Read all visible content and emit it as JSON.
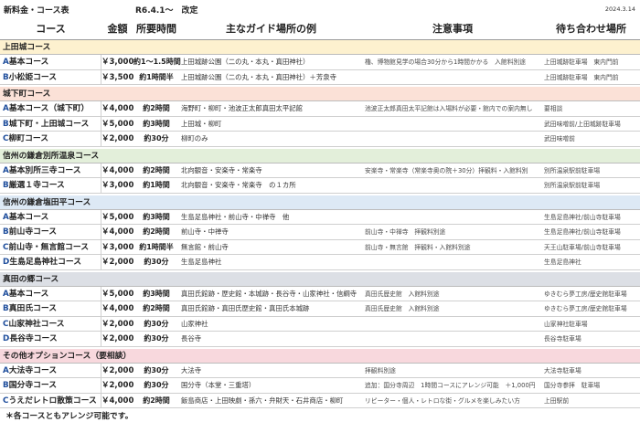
{
  "title": "新料金・コース表",
  "revision": "R6.4.1～　改定",
  "date": "2024.3.14",
  "columns": {
    "course": "コース",
    "price": "金額",
    "time": "所要時間",
    "places": "主なガイド場所の例",
    "notes": "注意事項",
    "meeting": "待ち合わせ場所"
  },
  "colors": {
    "letter": "#1f4e9c"
  },
  "sections": [
    {
      "name": "上田城コース",
      "color": "#fdf1cf",
      "rows": [
        {
          "letter": "A",
          "course": "基本コース",
          "price": "￥3,000",
          "time": "約1～1.5時間",
          "places": "上田城跡公園（二の丸・本丸・真田神社）",
          "notes": "櫓、博物館見学の場合30分から1時間かかる　入館料別途",
          "meeting": "上田城跡駐車場　東内門前"
        },
        {
          "letter": "B",
          "course": "小松姫コース",
          "price": "￥3,500",
          "time": "約1時間半",
          "places": "上田城跡公園（二の丸・本丸・真田神社）＋芳泉寺",
          "meeting": "上田城跡駐車場　東内門前"
        }
      ]
    },
    {
      "name": "城下町コース",
      "color": "#fbe1d7",
      "rows": [
        {
          "letter": "A",
          "course": "基本コース（城下町）",
          "price": "￥4,000",
          "time": "約2時間",
          "places": "海野町・柳町・池波正太郎真田太平記館",
          "notes": "池波正太郎真田太平記館は入場料が必要・館内での案内無し",
          "meeting": "要相談"
        },
        {
          "letter": "B",
          "course": "城下町・上田城コース",
          "price": "￥5,000",
          "time": "約3時間",
          "places": "上田城・柳町",
          "meeting": "武田味噌前/上田城跡駐車場"
        },
        {
          "letter": "C",
          "course": "柳町コース",
          "price": "￥2,000",
          "time": "約30分",
          "places": "柳町のみ",
          "meeting": "武田味噌前"
        }
      ]
    },
    {
      "name": "信州の鎌倉別所温泉コース",
      "color": "#e3efda",
      "rows": [
        {
          "letter": "A",
          "course": "基本別所三寺コース",
          "price": "￥4,000",
          "time": "約2時間",
          "places": "北向観音・安楽寺・常楽寺",
          "notes": "安楽寺・常楽寺（常楽寺奥の院＋30分）拝観料・入館料別",
          "meeting": "別所温泉駅前駐車場"
        },
        {
          "letter": "B",
          "course": "厳選１寺コース",
          "price": "￥3,000",
          "time": "約1時間",
          "places": "北向観音・安楽寺・常楽寺　の１カ所",
          "meeting": "別所温泉駅前駐車場"
        }
      ]
    },
    {
      "name": "信州の鎌倉塩田平コース",
      "color": "#dde9f5",
      "rows": [
        {
          "letter": "A",
          "course": "基本コース",
          "price": "￥5,000",
          "time": "約3時間",
          "places": "生島足島神社・前山寺・中禅寺　他",
          "meeting": "生島足島神社/前山寺駐車場"
        },
        {
          "letter": "B",
          "course": "前山寺コース",
          "price": "￥4,000",
          "time": "約2時間",
          "places": "前山寺・中禅寺",
          "notes": "前山寺・中禅寺　拝観料別途",
          "meeting": "生島足島神社/前山寺駐車場"
        },
        {
          "letter": "C",
          "course": "前山寺・無言館コース",
          "price": "￥3,000",
          "time": "約1時間半",
          "places": "無言館・前山寺",
          "notes": "前山寺・無言館　拝観料・入館料別途",
          "meeting": "天王山駐車場/前山寺駐車場"
        },
        {
          "letter": "D",
          "course": "生島足島神社コース",
          "price": "￥2,000",
          "time": "約30分",
          "places": "生島足島神社",
          "meeting": "生島足島神社"
        }
      ]
    },
    {
      "name": "真田の郷コース",
      "color": "#dcdfe5",
      "rows": [
        {
          "letter": "A",
          "course": "基本コース",
          "price": "￥5,000",
          "time": "約3時間",
          "places": "真田氏館跡・歴史館・本城跡・長谷寺・山家神社・信綱寺",
          "notes": "真田氏歴史館　入館料別途",
          "meeting": "ゆきむら夢工房/歴史館駐車場"
        },
        {
          "letter": "B",
          "course": "真田氏コース",
          "price": "￥4,000",
          "time": "約2時間",
          "places": "真田氏館跡・真田氏歴史館・真田氏本城跡",
          "notes": "真田氏歴史館　入館料別途",
          "meeting": "ゆきむら夢工房/歴史館駐車場"
        },
        {
          "letter": "C",
          "course": "山家神社コース",
          "price": "￥2,000",
          "time": "約30分",
          "places": "山家神社",
          "meeting": "山家神社駐車場"
        },
        {
          "letter": "D",
          "course": "長谷寺コース",
          "price": "￥2,000",
          "time": "約30分",
          "places": "長谷寺",
          "meeting": "長谷寺駐車場"
        }
      ]
    },
    {
      "name": "その他オプションコース（要相談）",
      "color": "#f8d8dd",
      "rows": [
        {
          "letter": "A",
          "course": "大法寺コース",
          "price": "￥2,000",
          "time": "約30分",
          "places": "大法寺",
          "notes": "拝観料別途",
          "meeting": "大法寺駐車場"
        },
        {
          "letter": "B",
          "course": "国分寺コース",
          "price": "￥2,000",
          "time": "約30分",
          "places": "国分寺（本堂・三重塔）",
          "notes": "追加：国分寺周辺　1時間コースにアレンジ可能　＋1,000円",
          "meeting": "国分寺参拝　駐車場"
        },
        {
          "letter": "C",
          "course": "うえだレトロ散策コース",
          "price": "￥4,000",
          "time": "約2時間",
          "places": "飯島商店・上田映劇・孫六・弁財天・石井商店・柳町",
          "notes": "リピーター・個人・レトロな街・グルメを楽しみたい方",
          "meeting": "上田駅前"
        }
      ]
    }
  ],
  "footnote": "＊各コースともアレンジ可能です。"
}
